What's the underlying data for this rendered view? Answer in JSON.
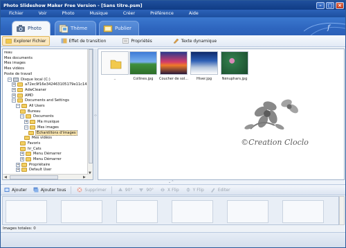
{
  "window": {
    "title": "Photo Slideshow Maker Free Version - [Sans titre.psm]"
  },
  "menu": [
    "Fichier",
    "Voir",
    "Photo",
    "Musique",
    "Créer",
    "Préférence",
    "Aide"
  ],
  "tabs": [
    {
      "label": "Photo",
      "active": true
    },
    {
      "label": "Thème",
      "active": false
    },
    {
      "label": "Publier",
      "active": false
    }
  ],
  "subtoolbar": {
    "explorer": "Explorer Fichier",
    "transition": "Effet de transition",
    "properties": "Propriétés",
    "dynamic_text": "Texte dynamique"
  },
  "tree": [
    {
      "label": "reau",
      "indent": 0,
      "icon": "none",
      "expander": ""
    },
    {
      "label": "Mes documents",
      "indent": 0,
      "icon": "none",
      "expander": ""
    },
    {
      "label": "Mes images",
      "indent": 0,
      "icon": "none",
      "expander": ""
    },
    {
      "label": "Mes vidéos",
      "indent": 0,
      "icon": "none",
      "expander": ""
    },
    {
      "label": "Poste de travail",
      "indent": 0,
      "icon": "none",
      "expander": ""
    },
    {
      "label": "Disque local (C:)",
      "indent": 1,
      "icon": "drive",
      "expander": "−"
    },
    {
      "label": "a72ec9f16e342463105179e11c143857",
      "indent": 2,
      "icon": "folder",
      "expander": "+"
    },
    {
      "label": "AdwCleaner",
      "indent": 2,
      "icon": "folder",
      "expander": "+"
    },
    {
      "label": "AMD",
      "indent": 2,
      "icon": "folder",
      "expander": "+"
    },
    {
      "label": "Documents and Settings",
      "indent": 2,
      "icon": "folder",
      "expander": "−"
    },
    {
      "label": "All Users",
      "indent": 3,
      "icon": "folder",
      "expander": "−"
    },
    {
      "label": "Bureau",
      "indent": 4,
      "icon": "folder",
      "expander": ""
    },
    {
      "label": "Documents",
      "indent": 4,
      "icon": "folder",
      "expander": "−"
    },
    {
      "label": "Ma musique",
      "indent": 5,
      "icon": "folder",
      "expander": "+"
    },
    {
      "label": "Mes images",
      "indent": 5,
      "icon": "folder",
      "expander": "−"
    },
    {
      "label": "Échantillons d'images",
      "indent": 6,
      "icon": "folder",
      "expander": "",
      "selected": true
    },
    {
      "label": "Mes vidéos",
      "indent": 5,
      "icon": "folder",
      "expander": ""
    },
    {
      "label": "Favoris",
      "indent": 4,
      "icon": "folder",
      "expander": ""
    },
    {
      "label": "hr_Cats",
      "indent": 4,
      "icon": "folder",
      "expander": ""
    },
    {
      "label": "Menu Démarrer",
      "indent": 4,
      "icon": "folder",
      "expander": "+"
    },
    {
      "label": "Menu Démarrer",
      "indent": 4,
      "icon": "folder",
      "expander": "+"
    },
    {
      "label": "Propriétaire",
      "indent": 3,
      "icon": "folder",
      "expander": "+"
    },
    {
      "label": "Default User",
      "indent": 3,
      "icon": "folder",
      "expander": "+"
    }
  ],
  "files": [
    {
      "name": "..",
      "kind": "folder"
    },
    {
      "name": "Collines.jpg",
      "kind": "hills"
    },
    {
      "name": "Coucher de sol...",
      "kind": "sunset"
    },
    {
      "name": "Hiver.jpg",
      "kind": "winter"
    },
    {
      "name": "Nénuphars.jpg",
      "kind": "lilies"
    }
  ],
  "watermark": "©Creation Cloclo",
  "bottom_toolbar": {
    "add": "Ajouter",
    "add_all": "Ajouter tous",
    "delete": "Supprimer",
    "rot_left": "90°",
    "rot_right": "90°",
    "xflip": "X Flip",
    "yflip": "Y Flip",
    "edit": "Editer"
  },
  "timeline_slots": 6,
  "status": "Images totales: 0",
  "colors": {
    "accent": "#2c62b8",
    "title_bar": "#1f4f9c",
    "selection": "#fce7b0"
  }
}
